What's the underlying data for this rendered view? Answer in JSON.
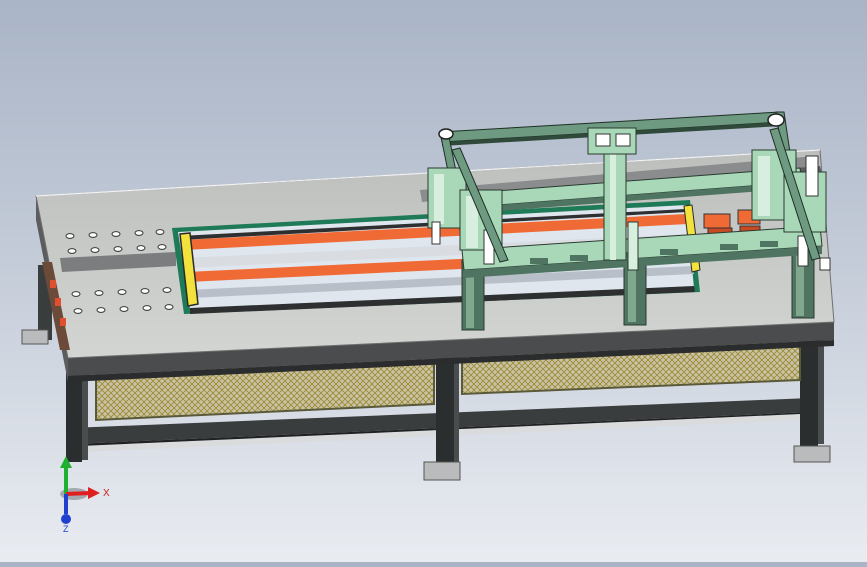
{
  "viewport": {
    "background_top": "#a9b4c6",
    "background_bottom": "#e9ecf1"
  },
  "colors": {
    "table_top": "#c4c6c4",
    "table_edge": "#6f706f",
    "frame_dark": "#2f3233",
    "tray_frame": "#1e7a57",
    "tray_orange": "#f06a35",
    "tray_white": "#e8eef5",
    "gantry_green": "#a9d8b8",
    "gantry_dark": "#4f7461",
    "mesh": "#b79c34",
    "yellow_bar": "#f2e23b"
  },
  "triad": {
    "x_label": "X",
    "z_label": "Z",
    "x_color": "#e02020",
    "y_color": "#20b030",
    "z_color": "#2040d0",
    "x_icon": "axis-x-arrow-icon",
    "y_icon": "axis-y-arrow-icon",
    "z_icon": "axis-z-arrow-icon"
  }
}
